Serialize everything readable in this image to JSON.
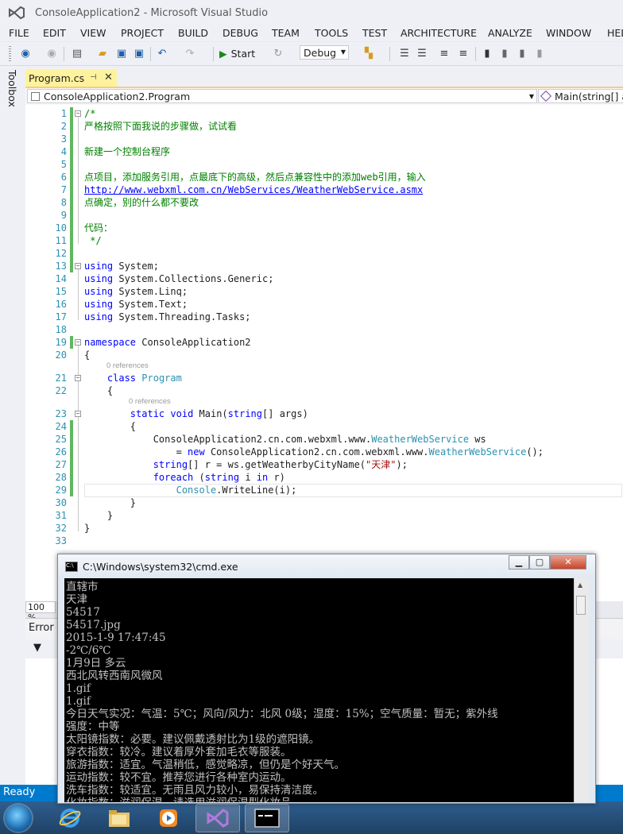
{
  "window": {
    "title": "ConsoleApplication2 - Microsoft Visual Studio"
  },
  "menu": [
    "FILE",
    "EDIT",
    "VIEW",
    "PROJECT",
    "BUILD",
    "DEBUG",
    "TEAM",
    "TOOLS",
    "TEST",
    "ARCHITECTURE",
    "ANALYZE",
    "WINDOW",
    "HELP"
  ],
  "toolbar": {
    "start_label": "Start",
    "config": "Debug"
  },
  "toolbox_label": "Toolbox",
  "tab": {
    "label": "Program.cs",
    "pin": "⊣",
    "close": "✕"
  },
  "nav": {
    "left": "ConsoleApplication2.Program",
    "right": "Main(string[] args)"
  },
  "codelens": [
    "0 references",
    "0 references"
  ],
  "code": [
    {
      "n": "1",
      "segs": [
        {
          "c": "cm",
          "t": "/*"
        }
      ]
    },
    {
      "n": "2",
      "segs": [
        {
          "c": "cm",
          "t": "严格按照下面我说的步骤做，试试看"
        }
      ]
    },
    {
      "n": "3",
      "segs": []
    },
    {
      "n": "4",
      "segs": [
        {
          "c": "cm",
          "t": "新建一个控制台程序"
        }
      ]
    },
    {
      "n": "5",
      "segs": []
    },
    {
      "n": "6",
      "segs": [
        {
          "c": "cm",
          "t": "点项目，添加服务引用，点最底下的高级，然后点兼容性中的添加web引用，输入"
        }
      ]
    },
    {
      "n": "7",
      "segs": [
        {
          "c": "lk",
          "t": "http://www.webxml.com.cn/WebServices/WeatherWebService.asmx"
        }
      ]
    },
    {
      "n": "8",
      "segs": [
        {
          "c": "cm",
          "t": "点确定，别的什么都不要改"
        }
      ]
    },
    {
      "n": "9",
      "segs": []
    },
    {
      "n": "10",
      "segs": [
        {
          "c": "cm",
          "t": "代码："
        }
      ]
    },
    {
      "n": "11",
      "segs": [
        {
          "c": "cm",
          "t": " */"
        }
      ]
    },
    {
      "n": "12",
      "segs": []
    },
    {
      "n": "13",
      "segs": [
        {
          "c": "kw",
          "t": "using"
        },
        {
          "c": "",
          "t": " System;"
        }
      ]
    },
    {
      "n": "14",
      "segs": [
        {
          "c": "kw",
          "t": "using"
        },
        {
          "c": "",
          "t": " System.Collections.Generic;"
        }
      ]
    },
    {
      "n": "15",
      "segs": [
        {
          "c": "kw",
          "t": "using"
        },
        {
          "c": "",
          "t": " System.Linq;"
        }
      ]
    },
    {
      "n": "16",
      "segs": [
        {
          "c": "kw",
          "t": "using"
        },
        {
          "c": "",
          "t": " System.Text;"
        }
      ]
    },
    {
      "n": "17",
      "segs": [
        {
          "c": "kw",
          "t": "using"
        },
        {
          "c": "",
          "t": " System.Threading.Tasks;"
        }
      ]
    },
    {
      "n": "18",
      "segs": []
    },
    {
      "n": "19",
      "segs": [
        {
          "c": "kw",
          "t": "namespace"
        },
        {
          "c": "",
          "t": " ConsoleApplication2"
        }
      ]
    },
    {
      "n": "20",
      "segs": [
        {
          "c": "",
          "t": "{"
        }
      ]
    },
    {
      "n": "21",
      "segs": [
        {
          "c": "",
          "t": "    "
        },
        {
          "c": "kw",
          "t": "class"
        },
        {
          "c": "",
          "t": " "
        },
        {
          "c": "ty",
          "t": "Program"
        }
      ]
    },
    {
      "n": "22",
      "segs": [
        {
          "c": "",
          "t": "    {"
        }
      ]
    },
    {
      "n": "23",
      "segs": [
        {
          "c": "",
          "t": "        "
        },
        {
          "c": "kw",
          "t": "static"
        },
        {
          "c": "",
          "t": " "
        },
        {
          "c": "kw",
          "t": "void"
        },
        {
          "c": "",
          "t": " Main("
        },
        {
          "c": "kw",
          "t": "string"
        },
        {
          "c": "",
          "t": "[] args)"
        }
      ]
    },
    {
      "n": "24",
      "segs": [
        {
          "c": "",
          "t": "        {"
        }
      ]
    },
    {
      "n": "25",
      "segs": [
        {
          "c": "",
          "t": "            ConsoleApplication2.cn.com.webxml.www."
        },
        {
          "c": "ty",
          "t": "WeatherWebService"
        },
        {
          "c": "",
          "t": " ws"
        }
      ]
    },
    {
      "n": "26",
      "segs": [
        {
          "c": "",
          "t": "                = "
        },
        {
          "c": "kw",
          "t": "new"
        },
        {
          "c": "",
          "t": " ConsoleApplication2.cn.com.webxml.www."
        },
        {
          "c": "ty",
          "t": "WeatherWebService"
        },
        {
          "c": "",
          "t": "();"
        }
      ]
    },
    {
      "n": "27",
      "segs": [
        {
          "c": "",
          "t": "            "
        },
        {
          "c": "kw",
          "t": "string"
        },
        {
          "c": "",
          "t": "[] r = ws.getWeatherbyCityName("
        },
        {
          "c": "st",
          "t": "\"天津\""
        },
        {
          "c": "",
          "t": ");"
        }
      ]
    },
    {
      "n": "28",
      "segs": [
        {
          "c": "",
          "t": "            "
        },
        {
          "c": "kw",
          "t": "foreach"
        },
        {
          "c": "",
          "t": " ("
        },
        {
          "c": "kw",
          "t": "string"
        },
        {
          "c": "",
          "t": " i "
        },
        {
          "c": "kw",
          "t": "in"
        },
        {
          "c": "",
          "t": " r)"
        }
      ]
    },
    {
      "n": "29",
      "segs": [
        {
          "c": "",
          "t": "                "
        },
        {
          "c": "ty",
          "t": "Console"
        },
        {
          "c": "",
          "t": ".WriteLine(i);"
        }
      ]
    },
    {
      "n": "30",
      "segs": [
        {
          "c": "",
          "t": "        }"
        }
      ]
    },
    {
      "n": "31",
      "segs": [
        {
          "c": "",
          "t": "    }"
        }
      ]
    },
    {
      "n": "32",
      "segs": [
        {
          "c": "",
          "t": "}"
        }
      ]
    },
    {
      "n": "33",
      "segs": []
    }
  ],
  "zoom": "100 %",
  "error_panel": {
    "tab": "Error",
    "filter_icon": "▼"
  },
  "status": {
    "text": "Ready"
  },
  "cmd": {
    "title": "C:\\Windows\\system32\\cmd.exe",
    "lines": [
      "直辖市",
      "天津",
      "54517",
      "54517.jpg",
      "2015-1-9 17:47:45",
      "-2℃/6℃",
      "1月9日 多云",
      "西北风转西南风微风",
      "1.gif",
      "1.gif",
      "今日天气实况：气温：5℃；风向/风力：北风 0级；湿度：15%；空气质量：暂无；紫外线",
      "强度：中等",
      "太阳镜指数：必要。建议佩戴透射比为1级的遮阳镜。",
      "穿衣指数：较冷。建议着厚外套加毛衣等服装。",
      "旅游指数：适宜。气温稍低，感觉略凉，但仍是个好天气。",
      "运动指数：较不宜。推荐您进行各种室内运动。",
      "洗车指数：较适宜。无雨且风力较小，易保持清洁度。",
      "化妆指数：滋润保湿。请选用滋润保湿型化妆品。"
    ]
  },
  "taskbar": [
    "internet-explorer",
    "file-explorer",
    "media-player",
    "visual-studio",
    "command-prompt"
  ]
}
